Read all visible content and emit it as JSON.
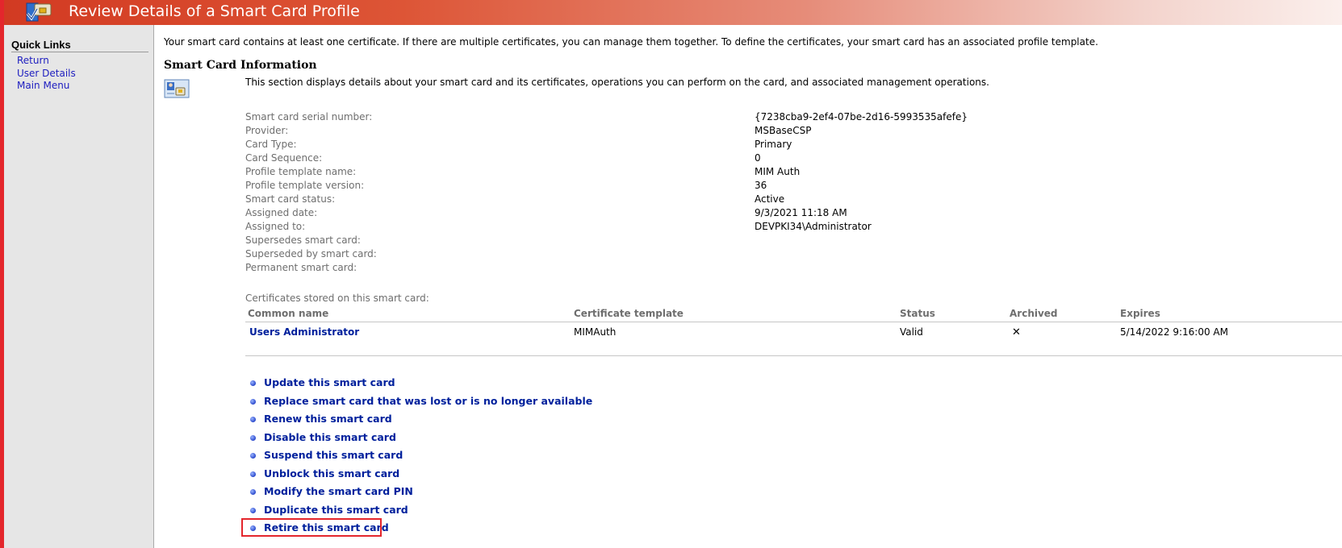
{
  "header": {
    "title": "Review Details of a Smart Card Profile",
    "logo_icon": "smart-card-check-icon"
  },
  "sidebar": {
    "title": "Quick Links",
    "links": [
      "Return",
      "User Details",
      "Main Menu"
    ]
  },
  "content": {
    "intro": "Your smart card contains at least one certificate. If there are multiple certificates, you can manage them together. To define the certificates, your smart card has an associated profile template.",
    "section_title": "Smart Card Information",
    "section_icon": "smart-card-info-icon",
    "section_desc": "This section displays details about your smart card and its certificates, operations you can perform on the card, and associated management operations."
  },
  "details": [
    {
      "label": "Smart card serial number:",
      "value": "{7238cba9-2ef4-07be-2d16-5993535afefe}"
    },
    {
      "label": "Provider:",
      "value": "MSBaseCSP"
    },
    {
      "label": "Card Type:",
      "value": "Primary"
    },
    {
      "label": "Card Sequence:",
      "value": "0"
    },
    {
      "label": "Profile template name:",
      "value": "MIM Auth"
    },
    {
      "label": "Profile template version:",
      "value": "36"
    },
    {
      "label": "Smart card status:",
      "value": "Active"
    },
    {
      "label": "Assigned date:",
      "value": "9/3/2021 11:18 AM"
    },
    {
      "label": "Assigned to:",
      "value": "DEVPKI34\\Administrator"
    },
    {
      "label": "Supersedes smart card:",
      "value": ""
    },
    {
      "label": "Superseded by smart card:",
      "value": ""
    },
    {
      "label": "Permanent smart card:",
      "value": ""
    }
  ],
  "certificates": {
    "label": "Certificates stored on this smart card:",
    "columns": [
      "Common name",
      "Certificate template",
      "Status",
      "Archived",
      "Expires"
    ],
    "rows": [
      {
        "common_name": "Users Administrator",
        "template": "MIMAuth",
        "status": "Valid",
        "archived": "✕",
        "expires": "5/14/2022 9:16:00 AM"
      }
    ]
  },
  "actions": [
    "Update this smart card",
    "Replace smart card that was lost or is no longer available",
    "Renew this smart card",
    "Disable this smart card",
    "Suspend this smart card",
    "Unblock this smart card",
    "Modify the smart card PIN",
    "Duplicate this smart card",
    "Retire this smart card"
  ],
  "highlight": {
    "color": "#e4262c",
    "target": "Retire this smart card"
  }
}
